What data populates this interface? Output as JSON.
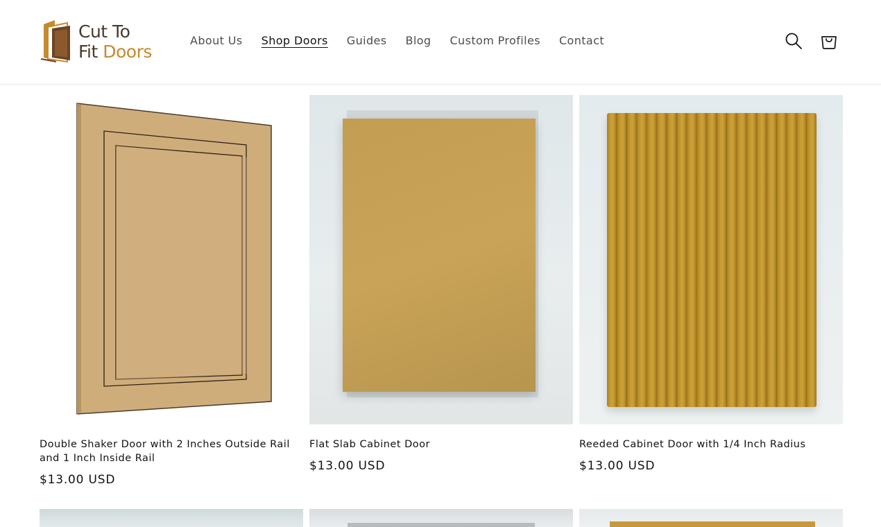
{
  "brand": {
    "line1": "Cut To",
    "line2_a": "Fit",
    "line2_b": "Doors",
    "colors": {
      "dark": "#4a3a2c",
      "gold": "#c58a2e"
    }
  },
  "nav": {
    "items": [
      {
        "label": "About Us",
        "active": false
      },
      {
        "label": "Shop Doors",
        "active": true
      },
      {
        "label": "Guides",
        "active": false
      },
      {
        "label": "Blog",
        "active": false
      },
      {
        "label": "Custom Profiles",
        "active": false
      },
      {
        "label": "Contact",
        "active": false
      }
    ]
  },
  "header_icons": {
    "search": "search-icon",
    "cart": "cart-icon"
  },
  "products": [
    {
      "title": "Double Shaker Door with 2 Inches Outside Rail and 1 Inch Inside Rail",
      "price": "$13.00 USD"
    },
    {
      "title": "Flat Slab Cabinet Door",
      "price": "$13.00 USD"
    },
    {
      "title": "Reeded Cabinet Door with 1/4 Inch Radius",
      "price": "$13.00 USD"
    }
  ]
}
